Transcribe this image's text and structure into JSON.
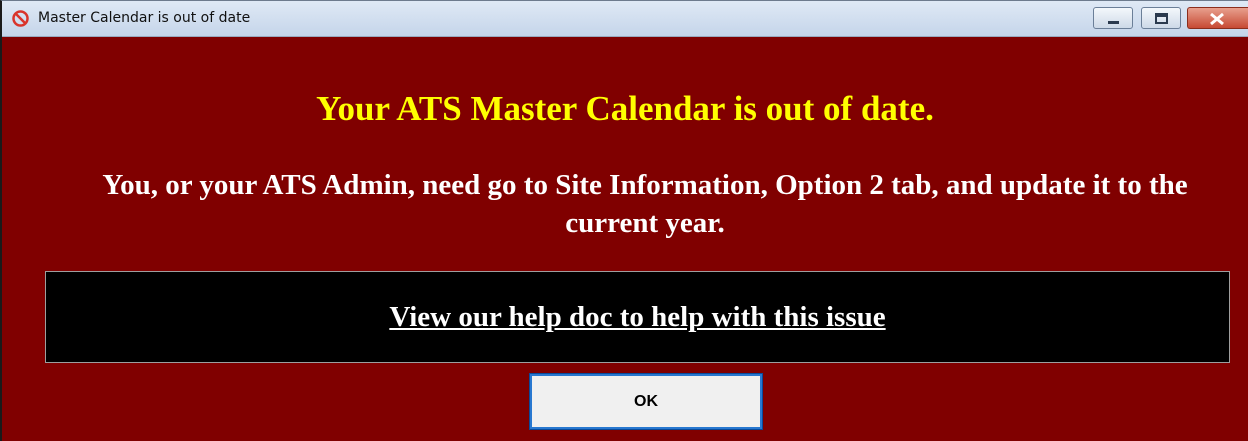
{
  "window": {
    "title": "Master Calendar is out of date",
    "title_icon": "no-entry-icon",
    "controls": {
      "minimize": "minimize-icon",
      "maximize": "maximize-icon",
      "close": "close-icon"
    }
  },
  "dialog": {
    "headline": "Your ATS Master Calendar is out of date.",
    "instruction": "You, or your ATS Admin, need go to Site Information, Option 2 tab, and update it to the current year.",
    "help_link": "View our help doc to help with this issue",
    "ok_label": "OK"
  },
  "colors": {
    "background": "#800000",
    "headline": "#ffff00",
    "body_text": "#ffffff",
    "help_box": "#000000",
    "button_border": "#2878d0"
  }
}
